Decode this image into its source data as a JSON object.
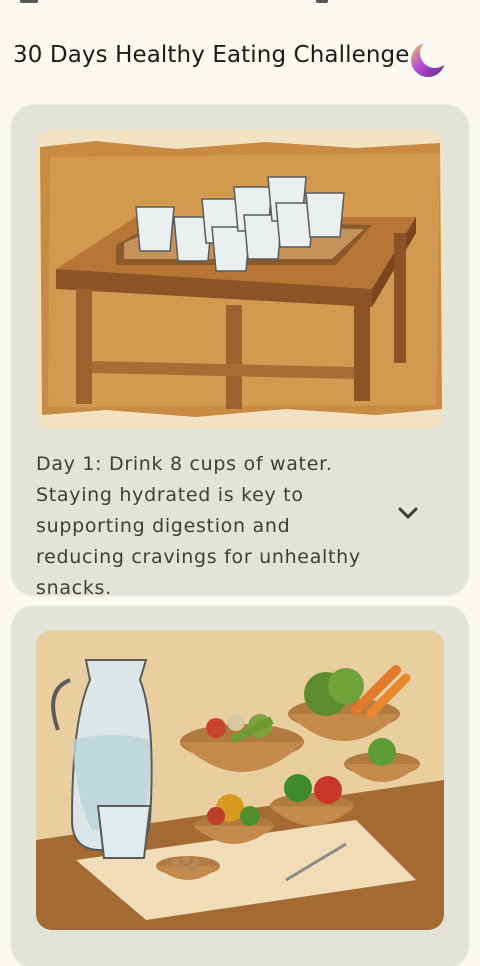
{
  "app": {
    "title": "30 Days Healthy Eating Challenge",
    "theme_toggle_icon": "moon-icon"
  },
  "colors": {
    "background": "#FCF8F2",
    "card": "#E2E3D9",
    "text": "#3f3e37",
    "moon_gradient": [
      "#F2C94C",
      "#B84ED9",
      "#5B2A86"
    ]
  },
  "cards": [
    {
      "image": "water-glasses-on-tray-illustration",
      "text": "Day 1: Drink 8 cups of water.\n Staying hydrated is key to supporting digestion and reducing cravings for unhealthy snacks.",
      "expand_icon": "chevron-down-icon"
    },
    {
      "image": "water-jug-and-vegetable-bowls-illustration",
      "text": "",
      "expand_icon": ""
    }
  ]
}
